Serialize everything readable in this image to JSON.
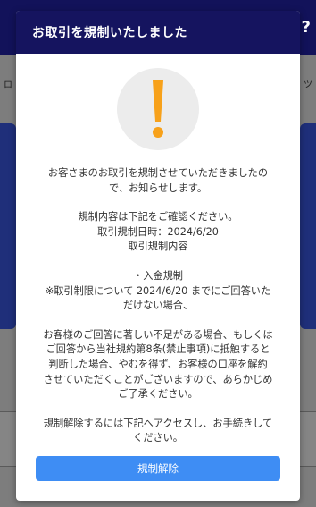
{
  "background": {
    "help_glyph": "?",
    "edge_left": "ロ",
    "edge_right": "ツ"
  },
  "modal": {
    "title": "お取引を規制いたしました",
    "icon": "warning-exclamation-icon",
    "accent_color": "#f7a11a",
    "paragraphs": [
      [
        "お客さまのお取引を規制させていただきましたの",
        "で、お知らせします。"
      ],
      [
        "規制内容は下記をご確認ください。",
        "取引規制日時：2024/6/20",
        "取引規制内容"
      ],
      [
        "・入金規制",
        "※取引制限について 2024/6/20 までにご回答いた",
        "だけない場合、"
      ],
      [
        "お客様のご回答に著しい不足がある場合、もしくは",
        "ご回答から当社規約第8条(禁止事項)に抵触すると",
        "判断した場合、やむを得ず、お客様の口座を解約",
        "させていただくことがございますので、あらかじめ",
        "ご了承ください。"
      ],
      [
        "規制解除するには下記へアクセスし、お手続きして",
        "ください。"
      ]
    ],
    "button_label": "規制解除"
  }
}
